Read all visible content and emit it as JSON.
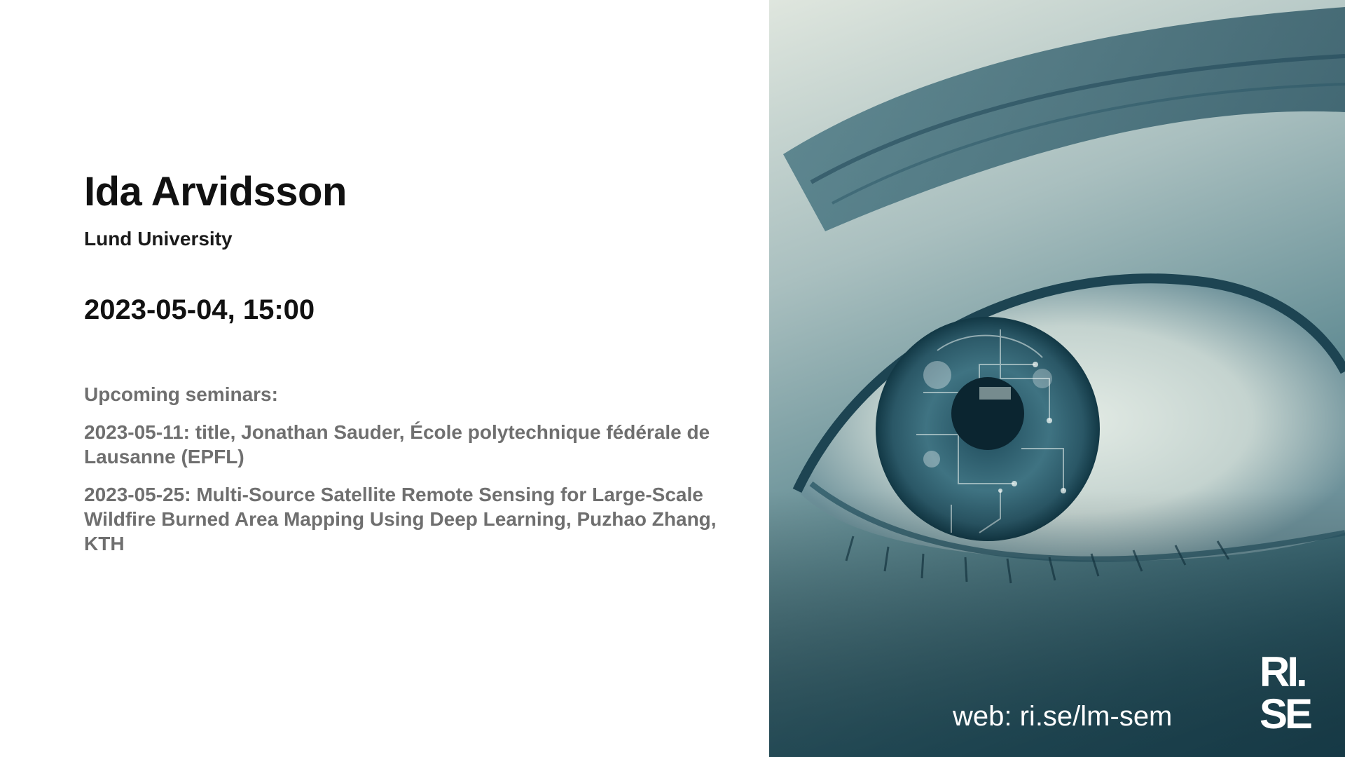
{
  "speaker": {
    "name": "Ida Arvidsson",
    "affiliation": "Lund University"
  },
  "datetime": "2023-05-04, 15:00",
  "upcoming": {
    "heading": "Upcoming seminars:",
    "items": [
      "2023-05-11: title, Jonathan Sauder, École polytechnique fédérale de Lausanne (EPFL)",
      "2023-05-25: Multi-Source Satellite Remote Sensing for Large-Scale Wildfire Burned Area Mapping Using Deep Learning, Puzhao Zhang, KTH"
    ]
  },
  "web": "web: ri.se/lm-sem",
  "logo": {
    "text_line1": "RI.",
    "text_line2": "SE",
    "color": "#ffffff"
  },
  "colors": {
    "title": "#111111",
    "upcoming": "#6f6f6f",
    "photo_tint": "#2f5d6a"
  }
}
